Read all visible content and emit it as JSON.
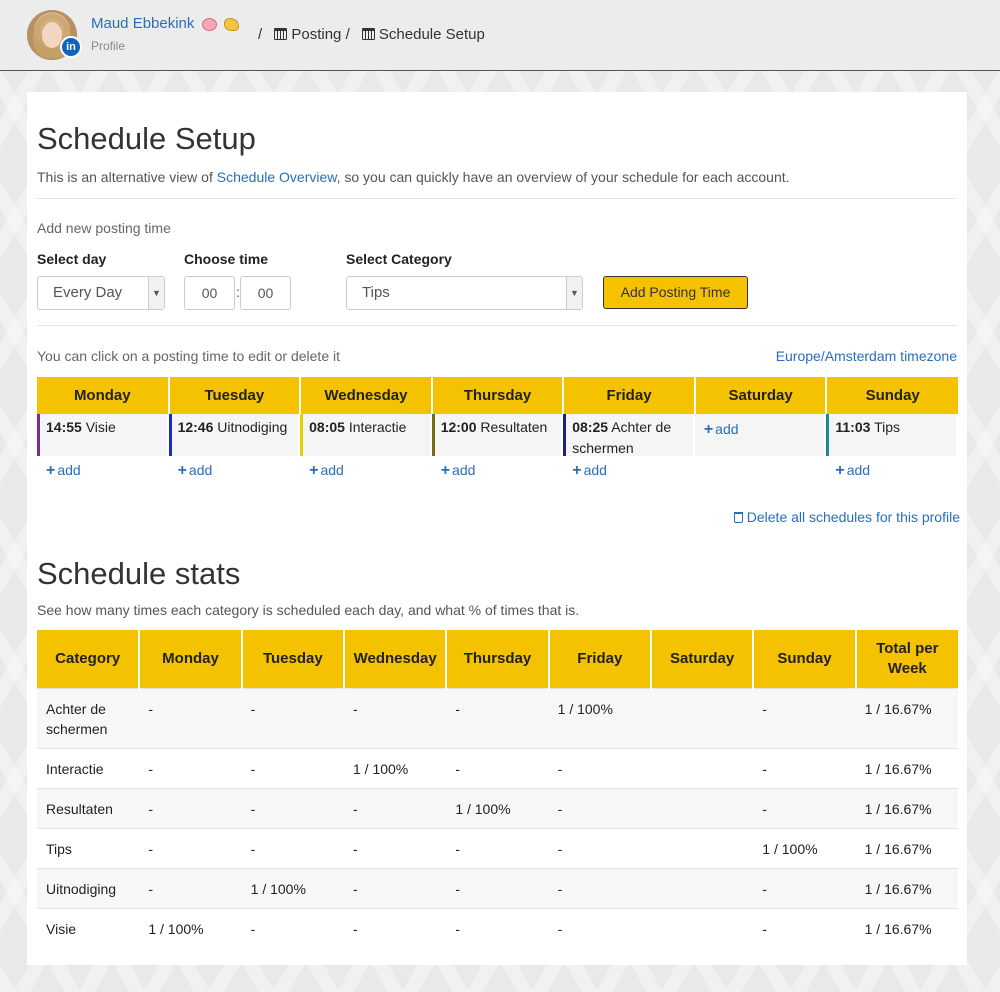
{
  "header": {
    "profile_name": "Maud Ebbekink",
    "profile_sub": "Profile",
    "badge": "in",
    "breadcrumb": [
      "Posting",
      "Schedule Setup"
    ]
  },
  "page": {
    "title": "Schedule Setup",
    "intro_before": "This is an alternative view of ",
    "intro_link": "Schedule Overview",
    "intro_after": ", so you can quickly have an overview of your schedule for each account."
  },
  "form": {
    "section_label": "Add new posting time",
    "day_label": "Select day",
    "day_value": "Every Day",
    "time_label": "Choose time",
    "hour": "00",
    "minute": "00",
    "category_label": "Select Category",
    "category_value": "Tips",
    "add_button": "Add Posting Time"
  },
  "schedule": {
    "hint": "You can click on a posting time to edit or delete it",
    "timezone": "Europe/Amsterdam timezone",
    "add_label": "add",
    "days": [
      {
        "name": "Monday",
        "time": "14:55",
        "category": "Visie",
        "color": "#7b2d8e"
      },
      {
        "name": "Tuesday",
        "time": "12:46",
        "category": "Uitnodiging",
        "color": "#1f2fb5"
      },
      {
        "name": "Wednesday",
        "time": "08:05",
        "category": "Interactie",
        "color": "#e6d200"
      },
      {
        "name": "Thursday",
        "time": "12:00",
        "category": "Resultaten",
        "color": "#7a6b16"
      },
      {
        "name": "Friday",
        "time": "08:25",
        "category": "Achter de schermen",
        "color": "#1a237e"
      },
      {
        "name": "Saturday",
        "time": "",
        "category": "",
        "color": ""
      },
      {
        "name": "Sunday",
        "time": "11:03",
        "category": "Tips",
        "color": "#1f8a8a"
      }
    ],
    "delete_all": "Delete all schedules for this profile"
  },
  "stats": {
    "title": "Schedule stats",
    "intro": "See how many times each category is scheduled each day, and what % of times that is.",
    "headers": [
      "Category",
      "Monday",
      "Tuesday",
      "Wednesday",
      "Thursday",
      "Friday",
      "Saturday",
      "Sunday",
      "Total per Week"
    ],
    "rows": [
      [
        "Achter de schermen",
        "-",
        "-",
        "-",
        "-",
        "1 / 100%",
        "",
        "-",
        "1 / 16.67%"
      ],
      [
        "Interactie",
        "-",
        "-",
        "1 / 100%",
        "-",
        "-",
        "",
        "-",
        "1 / 16.67%"
      ],
      [
        "Resultaten",
        "-",
        "-",
        "-",
        "1 / 100%",
        "-",
        "",
        "-",
        "1 / 16.67%"
      ],
      [
        "Tips",
        "-",
        "-",
        "-",
        "-",
        "-",
        "",
        "1 / 100%",
        "1 / 16.67%"
      ],
      [
        "Uitnodiging",
        "-",
        "1 / 100%",
        "-",
        "-",
        "-",
        "",
        "-",
        "1 / 16.67%"
      ],
      [
        "Visie",
        "1 / 100%",
        "-",
        "-",
        "-",
        "-",
        "",
        "-",
        "1 / 16.67%"
      ]
    ]
  }
}
